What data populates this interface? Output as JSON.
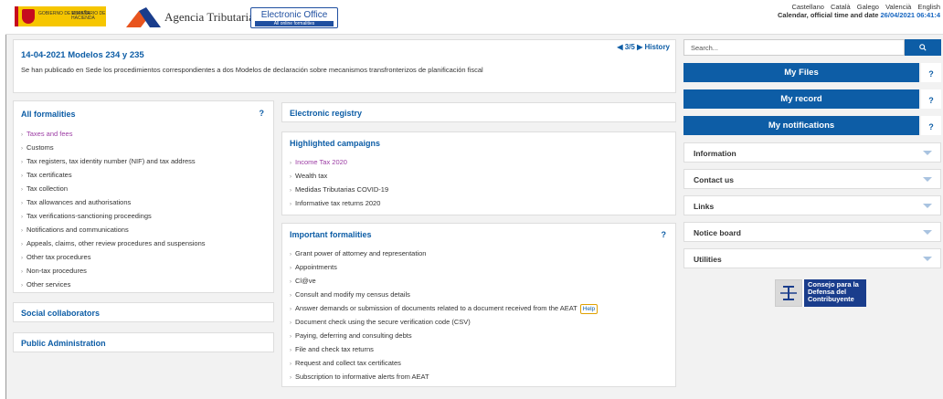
{
  "header": {
    "gov_logo_line1": "GOBIERNO DE ESPAÑA",
    "gov_logo_line2": "MINISTERIO DE HACIENDA",
    "agency_title": "Agencia Tributaria",
    "eo_main": "Electronic Office",
    "eo_sub": "All online formalities",
    "languages": [
      "Castellano",
      "Català",
      "Galego",
      "Valencià",
      "English"
    ],
    "calendar_label": "Calendar, official time and date ",
    "calendar_value": "26/04/2021 06:41:4"
  },
  "news": {
    "title": "14-04-2021  Modelos 234 y 235",
    "body": "Se han publicado en Sede los procedimientos correspondientes a dos Modelos de declaración sobre mecanismos transfronterizos de planificación fiscal",
    "pager": "◀ 3/5 ▶  History"
  },
  "all_formalities": {
    "title": "All formalities",
    "help": "?",
    "items": [
      "Taxes and fees",
      "Customs",
      "Tax registers, tax identity number (NIF) and tax address",
      "Tax certificates",
      "Tax collection",
      "Tax allowances and authorisations",
      "Tax verifications-sanctioning proceedings",
      "Notifications and communications",
      "Appeals, claims, other review procedures and suspensions",
      "Other tax procedures",
      "Non-tax procedures",
      "Other services"
    ]
  },
  "social_collaborators": {
    "title": "Social collaborators"
  },
  "public_administration": {
    "title": "Public Administration"
  },
  "electronic_registry": {
    "title": "Electronic registry"
  },
  "highlighted": {
    "title": "Highlighted campaigns",
    "items": [
      "Income Tax 2020",
      "Wealth tax",
      "Medidas Tributarias COVID-19",
      "Informative tax returns 2020"
    ]
  },
  "important": {
    "title": "Important formalities",
    "help": "?",
    "items": [
      "Grant power of attorney and representation",
      "Appointments",
      "Cl@ve",
      "Consult and modify my census details",
      "Answer demands or submission of documents related to a document received from the AEAT",
      "Document check using the secure verification code (CSV)",
      "Paying, deferring and consulting debts",
      "File and check tax returns",
      "Request and collect tax certificates",
      "Subscription to informative alerts from AEAT"
    ],
    "help_badge": "Help"
  },
  "sidebar": {
    "search_placeholder": "Search...",
    "search_icon": "search-icon",
    "buttons": [
      "My Files",
      "My record",
      "My notifications"
    ],
    "button_help": "?",
    "accordions": [
      "Information",
      "Contact us",
      "Links",
      "Notice board",
      "Utilities"
    ],
    "cdc_text": "Consejo para la Defensa del Contribuyente"
  },
  "colors": {
    "brand_blue": "#0d5da6",
    "visited": "#9c3ca4"
  }
}
